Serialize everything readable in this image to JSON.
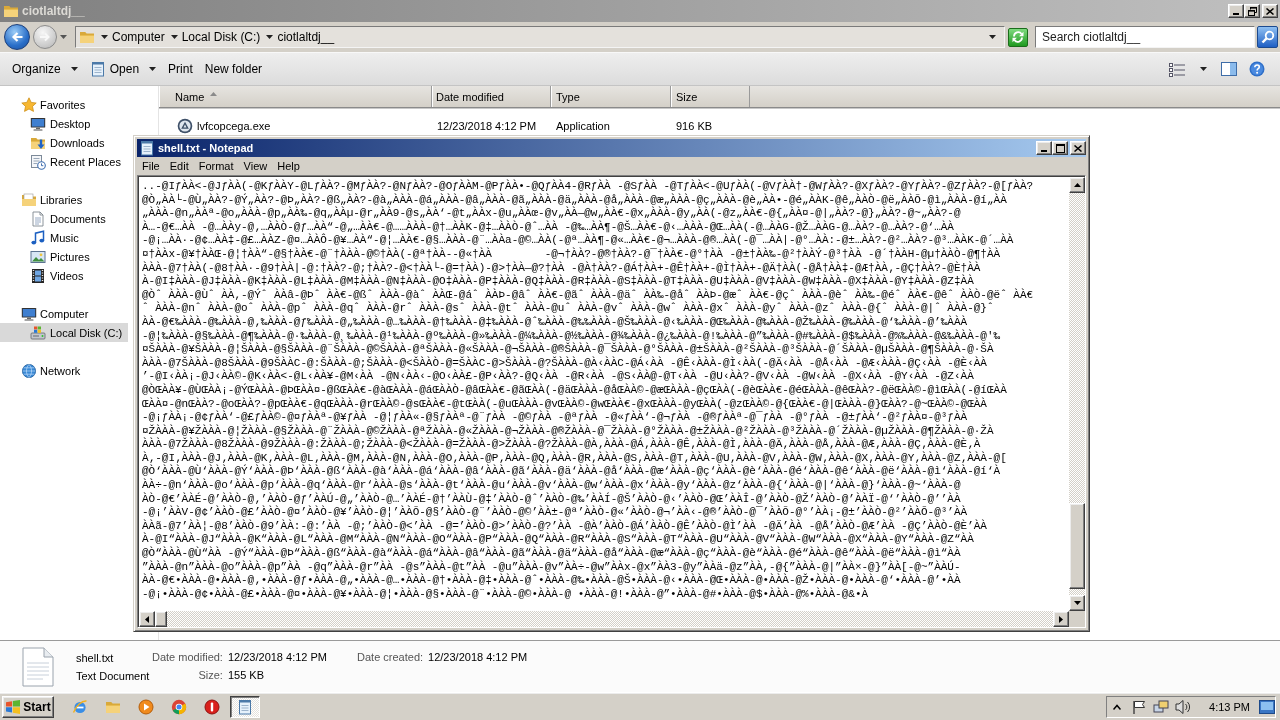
{
  "explorer": {
    "title": "ciotlaltdj__",
    "active": false,
    "breadcrumb": [
      "Computer",
      "Local Disk (C:)",
      "ciotlaltdj__"
    ],
    "search": {
      "placeholder": "Search ciotlaltdj__"
    },
    "toolbar": [
      {
        "label": "Organize",
        "kind": "menu"
      },
      {
        "label": "Open",
        "kind": "split"
      },
      {
        "label": "Print",
        "kind": "plain"
      },
      {
        "label": "New folder",
        "kind": "plain"
      }
    ],
    "sidebar": [
      {
        "label": "Favorites",
        "selected": false,
        "children": [
          {
            "label": "Desktop",
            "selected": false
          },
          {
            "label": "Downloads",
            "selected": false
          },
          {
            "label": "Recent Places",
            "selected": false
          }
        ]
      },
      {
        "label": "Libraries",
        "selected": false,
        "children": [
          {
            "label": "Documents",
            "selected": false
          },
          {
            "label": "Music",
            "selected": false
          },
          {
            "label": "Pictures",
            "selected": false
          },
          {
            "label": "Videos",
            "selected": false
          }
        ]
      },
      {
        "label": "Computer",
        "selected": false,
        "children": [
          {
            "label": "Local Disk (C:)",
            "selected": true
          }
        ]
      },
      {
        "label": "Network",
        "selected": false
      }
    ],
    "columns": [
      {
        "label": "Name",
        "sorted": true
      },
      {
        "label": "Date modified",
        "sorted": false
      },
      {
        "label": "Type",
        "sorted": false
      },
      {
        "label": "Size",
        "sorted": false
      }
    ],
    "rows": [
      {
        "cells": [
          "lvfcopcega.exe",
          "12/23/2018 4:12 PM",
          "Application",
          "916 KB"
        ],
        "selected": false
      }
    ],
    "details": {
      "name": "shell.txt",
      "type": "Text Document",
      "fields": [
        {
          "label": "Date modified:",
          "value": "12/23/2018 4:12 PM"
        },
        {
          "label": "Size:",
          "value": "155 KB"
        },
        {
          "label": "Date created:",
          "value": "12/23/2018 4:12 PM"
        }
      ]
    }
  },
  "notepad": {
    "title": "shell.txt - Notepad",
    "active": true,
    "menu": [
      "File",
      "Edit",
      "Format",
      "View",
      "Help"
    ],
    "lines": [
      "..-@IƒÀÀ<-@JƒÀÀ(-@KƒÀÀY-@LƒÀÀ?-@MƒÀÀ?-@NƒÀÀ?-@OƒÀÀM-@PƒÀÀ•-@QƒÀÀ4-@RƒÀÀ -@SƒÀÀ -@TƒÀÀ<-@UƒÀÀ(-@VƒÀÀ†-@WƒÀÀ?-@XƒÀÀ?-@YƒÀÀ?-@ZƒÀÀ?-@[ƒÀÀ?",
      "@Ò„ÀÀ└-@Ù„ÀÀ?-@Ý„ÀÀ?-@Þ„ÀÀ?-@ß„ÀÀ?-@à„ÀÀÀ-@á„ÀÀÀ-@â„ÀÀÀ-@ã„ÀÀÀ-@ä„ÀÀÀ-@å„ÀÀÀ-@æ„ÀÀÀ-@ç„ÀÀÀ-@è„ÀÀ•-@é„ÀÀK-@ê„ÀÀÒ-@ë„ÀÀÕ-@ì„ÀÀÀ-@í„ÀÀ",
      "„ÀÀÀ-@n„ÀÀª-@o„ÀÀÀ-@p„ÀÀ‰-@q„ÀÀµ-@r„ÀÀ9-@s„ÀÀ‘-@t„ÀÀx-@u„ÀÀœ-@v„ÀÀ—@w„ÀÀ€-@x„ÀÀÀ-@y„ÀÀ(-@z„ÀÀ€-@{„ÀÀ¤-@|„ÀÀ?-@}„ÀÀ?-@~„ÀÀ?-@",
      "À…-@€…ÀÀ -@…ÀÀy-@‚…ÀÀÒ-@ƒ…ÀÀ“-@„…ÀÀ€-@……ÀÀÀ-@†…ÀÀK-@‡…ÀÀÒ-@ˆ…ÀÀ -@‰…ÀÀ¶-@Š…ÀÀ€-@‹…ÀÀÀ-@Œ…ÀÀ(-@…ÀÀG-@Ž…ÀÀG-@…ÀÀ?-@…ÀÀ?-@‘…ÀÀ",
      "-@¡…ÀÀ·-@¢…ÀÀ‡-@£…ÀÀZ-@¤…ÀÀÔ-@¥…ÀÀ“-@¦…ÀÀ€-@§…ÀÀÀ-@¨…ÀÀa-@©…ÀÀ(-@ª…ÀÀ¶-@«…ÀÀ€-@¬…ÀÀÀ-@®…ÀÀ(-@¯…ÀÀ|-@°…ÀÀ:-@±…ÀÀ?-@²…ÀÀ?-@³…ÀÀK-@´…ÀÀ",
      "¤†ÀÀx-@¥†ÀÀŒ-@¦†ÀÀ“-@§†ÀÀ€-@¨†ÀÀÀ-@©†ÀÀ(-@ª†ÀÀ--@«†ÀÀ        -@¬†ÀÀ?-@®†ÀÀ?-@¯†ÀÀ€-@°†ÀÀ -@±†ÀÀ‰-@²†ÀÀÝ-@³†ÀÀ -@´†ÀÀH-@µ†ÀÀÒ-@¶†ÀÀ",
      "ÀÀÀ-@7†ÀÀ(-@8†ÀÀ·-@9†ÀÀ|-@:†ÀÀ?-@;†ÀÀ?-@<†ÀÀ└-@=†ÀÀ)-@>†ÀÀ—@?†ÀÀ -@À†ÀÀ?-@Á†ÀÀ+-@Ê†ÀÀ+-@Ì†ÀÀ+-@Ä†ÀÀ(-@Å†ÀÀ‡-@Æ†ÀÀ‚-@Ç†ÀÀ?-@È†ÀÀ",
      "À-@I‡ÀÀÀ-@J‡ÀÀÀ-@K‡ÀÀÀ-@L‡ÀÀÀ-@M‡ÀÀÀ-@N‡ÀÀÀ-@O‡ÀÀÀ-@P‡ÀÀÀ-@Q‡ÀÀÀ-@R‡ÀÀÀ-@S‡ÀÀÀ-@T‡ÀÀÀ-@U‡ÀÀÀ-@V‡ÀÀÀ-@W‡ÀÀÀ-@X‡ÀÀÀ-@Y‡ÀÀÀ-@Z‡ÀÀ",
      "@Òˆ ÀÀÀ-@Ùˆ ÀÀ,-@Ýˆ ÀÀâ-@Þˆ ÀÀ€-@ßˆ ÀÀÀ-@àˆ ÀÀŒ-@áˆ ÀÀÞ-@âˆ ÀÀ€-@ãˆ ÀÀÀ-@äˆ ÀÀ‰-@åˆ ÀÀÞ-@æˆ ÀÀ€-@çˆ ÀÀÀ-@èˆ ÀÀ‰-@éˆ ÀÀ€-@êˆ ÀÀÒ-@ëˆ ÀÀ€",
      "ˆ ÀÀÀ-@nˆ ÀÀÀ-@oˆ ÀÀÀ-@pˆ ÀÀÀ-@qˆ ÀÀÀ-@rˆ ÀÀÀ-@sˆ ÀÀÀ-@tˆ ÀÀÀ-@uˆ ÀÀÀ-@vˆ ÀÀÀ-@wˆ ÀÀÀ-@xˆ ÀÀÀ-@yˆ ÀÀÀ-@zˆ ÀÀÀ-@{ˆ ÀÀÀ-@|ˆ ÀÀÀ-@}ˆ",
      "ÀÀ-@€‰ÀÀÀ-@‰ÀÀÀ-@‚‰ÀÀÀ-@ƒ‰ÀÀÀ-@„‰ÀÀÀ-@…‰ÀÀÀ-@†‰ÀÀÀ-@‡‰ÀÀÀ-@ˆ‰ÀÀÀ-@‰‰ÀÀÀ-@Š‰ÀÀÀ-@‹‰ÀÀÀ-@Œ‰ÀÀÀ-@‰ÀÀÀ-@Ž‰ÀÀÀ-@‰ÀÀÀ-@‘‰ÀÀÀ-@’‰ÀÀÀ",
      "-@¦‰ÀÀÀ-@§‰ÀÀÀ-@¶‰ÀÀÀ-@·‰ÀÀÀ-@¸‰ÀÀÀ-@¹‰ÀÀÀ-@º‰ÀÀÀ-@»‰ÀÀÀ-@¼‰ÀÀÀ-@½‰ÀÀÀ-@¾‰ÀÀÀ-@¿‰ÀÀÀ-@!‰ÀÀÀ-@”‰ÀÀÀ-@#‰ÀÀÀ-@$‰ÀÀÀ-@%‰ÀÀÀ-@&‰ÀÀÀ-@'‰",
      "¤ŠÀÀÀ-@¥ŠÀÀÀ-@¦ŠÀÀÀ-@§ŠÀÀÀ-@¨ŠÀÀÀ-@©ŠÀÀÀ-@ªŠÀÀÀ-@«ŠÀÀÀ-@¬ŠÀÀÀ-@®ŠÀÀÀ-@¯ŠÀÀÀ-@°ŠÀÀÀ-@±ŠÀÀÀ-@²ŠÀÀÀ-@³ŠÀÀÀ-@´ŠÀÀÀ-@µŠÀÀÀ-@¶ŠÀÀÀ-@·ŠÀ",
      "ÀÀÀ-@7ŠÀÀÀ-@8ŠÀÀÀ-@9ŠÀÀC-@:ŠÀÀÀ-@;ŠÀÀÀ-@<ŠÀÀÒ-@=ŠÀÀC-@>ŠÀÀÀ-@?ŠÀÀÀ-@À‹ÀÀC-@Á‹ÀÀ -@Ê‹ÀÀÀ-@Ì‹ÀÀ(-@Ä‹ÀÀ -@Å‹ÀÀ -@Æ‹ÀÀÀ-@Ç‹ÀÀ -@È‹ÀÀ",
      "’-@I‹ÀÀ¡-@J‹ÀÀ©-@K‹ÀÀ<-@L‹ÀÀ¥-@M‹ÀÀ -@N‹ÀÀ‹-@O‹ÀÀ£-@P‹ÀÀ?-@Q‹ÀÀ -@R‹ÀÀ -@S‹ÀÀ@-@T‹ÀÀ -@U‹ÀÀ?-@V‹ÀÀ -@W‹ÀÀ -@X‹ÀÀ -@Y‹ÀÀ -@Z‹ÀÀ",
      "@ÒŒÀÀ¥-@ÙŒÀÀ¡-@ÝŒÀÀÀ-@ÞŒÀÀ¤-@ßŒÀÀ€-@àŒÀÀÀ-@áŒÀÀÒ-@âŒÀÀ€-@ãŒÀÀ(-@äŒÀÀÀ-@åŒÀÀ©-@æŒÀÀÀ-@çŒÀÀ(-@èŒÀÀ€-@éŒÀÀÀ-@êŒÀÀ?-@ëŒÀÀ©-@ìŒÀÀ(-@íŒÀÀ",
      "ŒÀÀ¤-@nŒÀÀ?-@oŒÀÀ?-@pŒÀÀ€-@qŒÀÀÀ-@rŒÀÀ©-@sŒÀÀ€-@tŒÀÀ(-@uŒÀÀÀ-@vŒÀÀ©-@wŒÀÀ€-@xŒÀÀÀ-@yŒÀÀ(-@zŒÀÀ©-@{ŒÀÀ€-@|ŒÀÀÀ-@}ŒÀÀ?-@~ŒÀÀ©-@ŒÀÀ",
      "-@¡ƒÀÀ¡-@¢ƒÀÀ‘-@£ƒÀÀ©-@¤ƒÀÀª-@¥ƒÀÀ -@¦ƒÀÀ«-@§ƒÀÀª-@¨ƒÀÀ -@©ƒÀÀ -@ªƒÀÀ -@«ƒÀÀ‘-@¬ƒÀÀ -@®ƒÀÀª-@¯ƒÀÀ -@°ƒÀÀ -@±ƒÀÀ‘-@²ƒÀÀ¤-@³ƒÀÀ",
      "¤ŽÀÀÀ-@¥ŽÀÀÀ-@¦ŽÀÀÀ-@§ŽÀÀÀ-@¨ŽÀÀÀ-@©ŽÀÀÀ-@ªŽÀÀÀ-@«ŽÀÀÀ-@¬ŽÀÀÀ-@®ŽÀÀÀ-@¯ŽÀÀÀ-@°ŽÀÀÀ-@±ŽÀÀÀ-@²ŽÀÀÀ-@³ŽÀÀÀ-@´ŽÀÀÀ-@µŽÀÀÀ-@¶ŽÀÀÀ-@·ŽÀ",
      "ÀÀÀ-@7ŽÀÀÀ-@8ŽÀÀÀ-@9ŽÀÀÀ-@:ŽÀÀÀ-@;ŽÀÀÀ-@<ŽÀÀÀ-@=ŽÀÀÀ-@>ŽÀÀÀ-@?ŽÀÀÀ-@À‚ÀÀÀ-@Á‚ÀÀÀ-@Ê‚ÀÀÀ-@Ì‚ÀÀÀ-@Ä‚ÀÀÀ-@Å‚ÀÀÀ-@Æ‚ÀÀÀ-@Ç‚ÀÀÀ-@È‚À",
      "À‚-@I‚ÀÀÀ-@J‚ÀÀÀ-@K‚ÀÀÀ-@L‚ÀÀÀ-@M‚ÀÀÀ-@N‚ÀÀÀ-@O‚ÀÀÀ-@P‚ÀÀÀ-@Q‚ÀÀÀ-@R‚ÀÀÀ-@S‚ÀÀÀ-@T‚ÀÀÀ-@U‚ÀÀÀ-@V‚ÀÀÀ-@W‚ÀÀÀ-@X‚ÀÀÀ-@Y‚ÀÀÀ-@Z‚ÀÀÀ-@[",
      "@Ò‘ÀÀÀ-@Ù‘ÀÀÀ-@Ý‘ÀÀÀ-@Þ‘ÀÀÀ-@ß‘ÀÀÀ-@à‘ÀÀÀ-@á‘ÀÀÀ-@â‘ÀÀÀ-@ã‘ÀÀÀ-@ä‘ÀÀÀ-@å‘ÀÀÀ-@æ‘ÀÀÀ-@ç‘ÀÀÀ-@è‘ÀÀÀ-@é‘ÀÀÀ-@ê‘ÀÀÀ-@ë‘ÀÀÀ-@ì‘ÀÀÀ-@í‘À",
      "ÀÀ÷-@n‘ÀÀÀ-@o‘ÀÀÀ-@p‘ÀÀÀ-@q‘ÀÀÀ-@r‘ÀÀÀ-@s‘ÀÀÀ-@t‘ÀÀÀ-@u‘ÀÀÀ-@v‘ÀÀÀ-@w‘ÀÀÀ-@x‘ÀÀÀ-@y‘ÀÀÀ-@z‘ÀÀÀ-@{‘ÀÀÀ-@|‘ÀÀÀ-@}‘ÀÀÀ-@~‘ÀÀÀ-@",
      "ÀÒ-@€’ÀÀÉ-@’ÀÀÒ-@‚’ÀÀÒ-@ƒ’ÀÀÚ-@„’ÀÀÒ-@…’ÀÀÉ-@†’ÀÀÙ-@‡’ÀÀÒ-@ˆ’ÀÀÒ-@‰’ÀÀÍ-@Š’ÀÀÒ-@‹’ÀÀÒ-@Œ’ÀÀÎ-@’ÀÀÒ-@Ž’ÀÀÒ-@’ÀÀÏ-@‘’ÀÀÒ-@’’ÀÀ",
      "-@¡’ÀÀV-@¢’ÀÀÒ-@£’ÀÀÒ-@¤’ÀÀÒ-@¥’ÀÀÒ-@¦’ÀÀÕ-@§’ÀÀÒ-@¨’ÀÀÒ-@©’ÀÀ±-@ª’ÀÀÒ-@«’ÀÀÒ-@¬’ÀÀ‹-@®’ÀÀÒ-@¯’ÀÀÕ-@°’ÀÀ¡-@±’ÀÀÒ-@²’ÀÀÕ-@³’ÀÀ",
      "ÀÀã-@7’ÀÀ¦-@8’ÀÀÒ-@9’ÀÀ:-@:’ÀÀ -@;’ÀÀÒ-@<’ÀÀ -@=’ÀÀÒ-@>’ÀÀÒ-@?’ÀÀ -@À’ÀÀÒ-@Á’ÀÀÒ-@Ê’ÀÀÒ-@Ì’ÀÀ -@Ä’ÀÀ -@Å’ÀÀÒ-@Æ’ÀÀ -@Ç’ÀÀÒ-@È’ÀÀ",
      "À-@I“ÀÀÀ-@J“ÀÀÀ-@K“ÀÀÀ-@L“ÀÀÀ-@M“ÀÀÀ-@N“ÀÀÀ-@O“ÀÀÀ-@P“ÀÀÀ-@Q“ÀÀÀ-@R“ÀÀÀ-@S“ÀÀÀ-@T“ÀÀÀ-@U“ÀÀÀ-@V“ÀÀÀ-@W“ÀÀÀ-@X“ÀÀÀ-@Y“ÀÀÀ-@Z“ÀÀ",
      "@Ò“ÀÀÀ-@Ù“ÀÀ -@Ý“ÀÀÀ-@Þ“ÀÀÀ-@ß“ÀÀÀ-@à“ÀÀÀ-@á“ÀÀÀ-@â“ÀÀÀ-@ã“ÀÀÀ-@ä“ÀÀÀ-@å“ÀÀÀ-@æ“ÀÀÀ-@ç“ÀÀÀ-@è“ÀÀÀ-@é“ÀÀÀ-@ê“ÀÀÀ-@ë“ÀÀÀ-@ì“ÀÀ",
      "”ÀÀÀ-@n”ÀÀÀ-@o”ÀÀÀ-@p”ÀÀ -@q”ÀÀÀ-@r”ÀÀ -@s”ÀÀÀ-@t”ÀÀ -@u”ÀÀÀ-@v”ÀÀ÷-@w”ÀÀx-@x”ÀÀ3-@y”ÀÀä-@z”ÀÀ,-@{”ÀÀÀ-@|”ÀÀ×-@}”ÀÀ[-@~”ÀÀÚ-",
      "ÀÀ-@€•ÀÀÀ-@•ÀÀÀ-@‚•ÀÀÀ-@ƒ•ÀÀÀ-@„•ÀÀÀ-@…•ÀÀÀ-@†•ÀÀÀ-@‡•ÀÀÀ-@ˆ•ÀÀÀ-@‰•ÀÀÀ-@Š•ÀÀÀ-@‹•ÀÀÀ-@Œ•ÀÀÀ-@•ÀÀÀ-@Ž•ÀÀÀ-@•ÀÀÀ-@‘•ÀÀÀ-@’•ÀÀ",
      "-@¡•ÀÀÀ-@¢•ÀÀÀ-@£•ÀÀÀ-@¤•ÀÀÀ-@¥•ÀÀÀ-@¦•ÀÀÀ-@§•ÀÀÀ-@¨•ÀÀÀ-@©•ÀÀÀ-@ •ÀÀÀ-@!•ÀÀÀ-@”•ÀÀÀ-@#•ÀÀÀ-@$•ÀÀÀ-@%•ÀÀÀ-@&•À"
    ]
  },
  "taskbar": {
    "start": "Start",
    "apps": [
      {
        "selected": false
      },
      {
        "selected": false
      },
      {
        "selected": false
      },
      {
        "selected": false
      },
      {
        "selected": false
      },
      {
        "selected": true
      }
    ],
    "clock": "4:13 PM"
  }
}
